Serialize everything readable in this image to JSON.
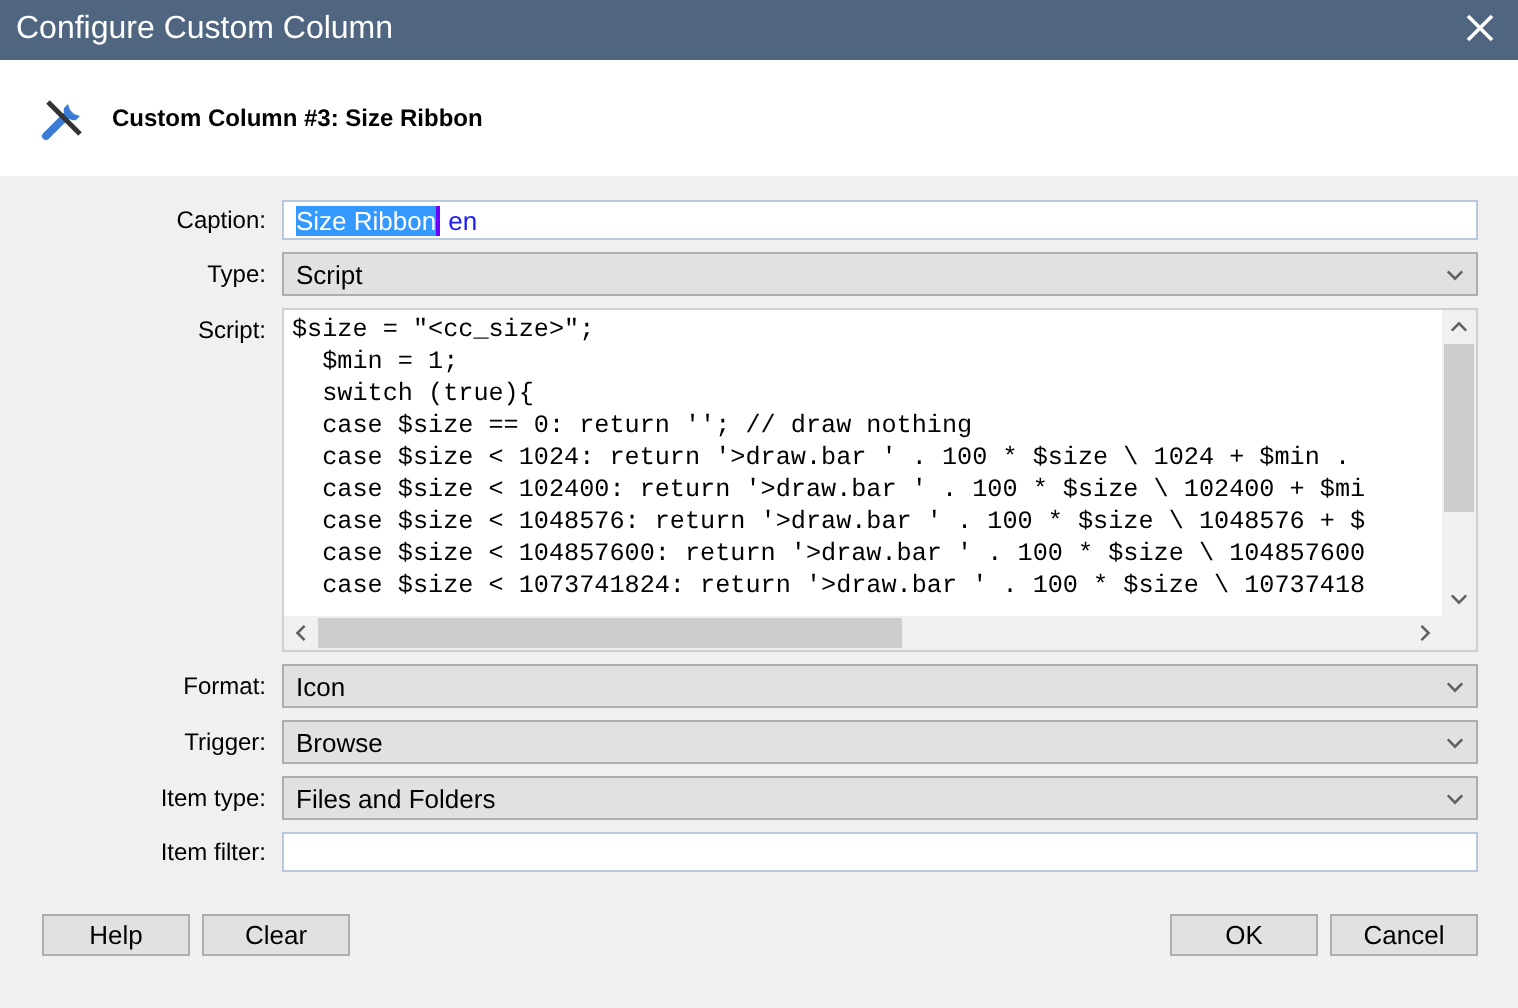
{
  "window": {
    "title": "Configure Custom Column"
  },
  "header": {
    "title": "Custom Column #3: Size Ribbon"
  },
  "fields": [
    {
      "kind": "text",
      "label": "Caption:",
      "selected_text": "Size Ribbon",
      "typed_text": "en"
    },
    {
      "kind": "select",
      "label": "Type:",
      "value": "Script"
    },
    {
      "kind": "script",
      "label": "Script:",
      "lines": [
        "$size = \"<cc_size>\";",
        "  $min = 1;",
        "  switch (true){",
        "  case $size == 0: return ''; // draw nothing",
        "  case $size < 1024: return '>draw.bar ' . 100 * $size \\ 1024 + $min .",
        "  case $size < 102400: return '>draw.bar ' . 100 * $size \\ 102400 + $mi",
        "  case $size < 1048576: return '>draw.bar ' . 100 * $size \\ 1048576 + $",
        "  case $size < 104857600: return '>draw.bar ' . 100 * $size \\ 104857600",
        "  case $size < 1073741824: return '>draw.bar ' . 100 * $size \\ 10737418"
      ]
    },
    {
      "kind": "select",
      "label": "Format:",
      "value": "Icon"
    },
    {
      "kind": "select",
      "label": "Trigger:",
      "value": "Browse"
    },
    {
      "kind": "select",
      "label": "Item type:",
      "value": "Files and Folders"
    },
    {
      "kind": "text",
      "label": "Item filter:"
    }
  ],
  "buttons_left": [
    "Help",
    "Clear"
  ],
  "buttons_right": [
    "OK",
    "Cancel"
  ]
}
